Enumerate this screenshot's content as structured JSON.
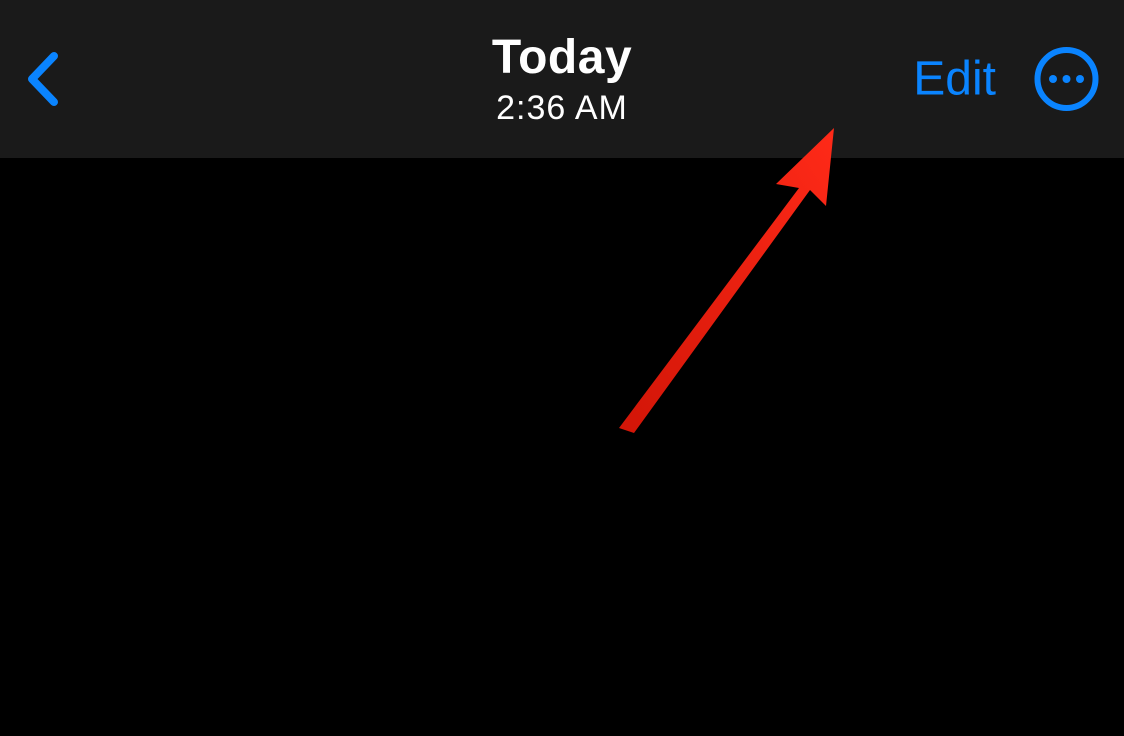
{
  "header": {
    "title": "Today",
    "subtitle": "2:36 AM",
    "edit_label": "Edit"
  },
  "colors": {
    "accent": "#0a84ff",
    "annotation": "#e31e10"
  }
}
